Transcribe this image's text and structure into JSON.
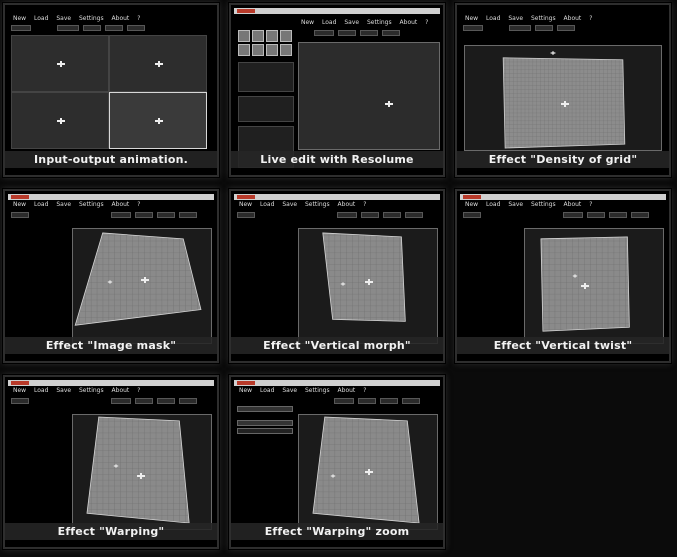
{
  "menu": {
    "items": [
      "New",
      "Load",
      "Save",
      "Settings",
      "About",
      "?"
    ]
  },
  "thumbnails": [
    {
      "id": "input-output",
      "caption": "Input-output animation."
    },
    {
      "id": "resolume",
      "caption": "Live edit with Resolume"
    },
    {
      "id": "density",
      "caption": "Effect \"Density of grid\""
    },
    {
      "id": "image-mask",
      "caption": "Effect \"Image mask\""
    },
    {
      "id": "vertical-morph",
      "caption": "Effect \"Vertical morph\""
    },
    {
      "id": "vertical-twist",
      "caption": "Effect \"Vertical twist\""
    },
    {
      "id": "warping",
      "caption": "Effect \"Warping\""
    },
    {
      "id": "warping-zoom",
      "caption": "Effect \"Warping\" zoom"
    }
  ],
  "colors": {
    "background": "#0b0b0b",
    "frame": "#2e2e2e",
    "viewport": "#1b1b1b",
    "quad_fill": "#8c8c8c",
    "quad_grid": "#6a6a6a",
    "caption_bg": "#262626",
    "caption_text": "#f2f2f2"
  },
  "icons": {
    "crosshair": "crosshair-icon",
    "point": "control-point-icon"
  }
}
